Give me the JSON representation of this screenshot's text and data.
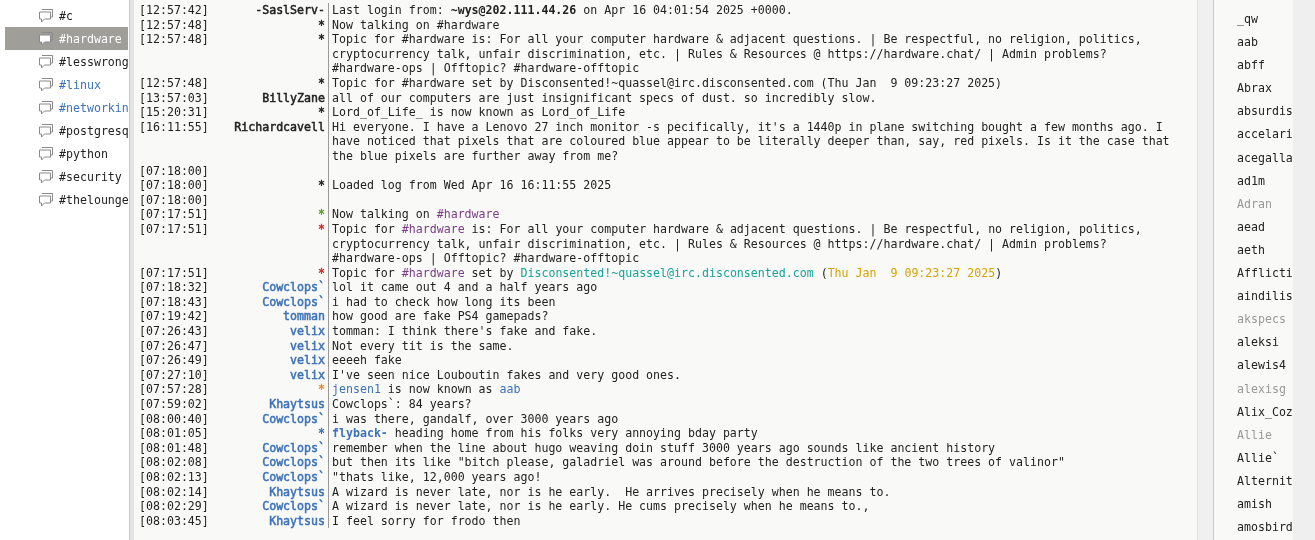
{
  "channels": [
    {
      "name": "#c",
      "selected": false,
      "activity": false
    },
    {
      "name": "#hardware",
      "selected": true,
      "activity": false
    },
    {
      "name": "#lesswrong",
      "selected": false,
      "activity": false
    },
    {
      "name": "#linux",
      "selected": false,
      "activity": true
    },
    {
      "name": "#networkin",
      "selected": false,
      "activity": true
    },
    {
      "name": "#postgresq",
      "selected": false,
      "activity": false
    },
    {
      "name": "#python",
      "selected": false,
      "activity": false
    },
    {
      "name": "#security",
      "selected": false,
      "activity": false
    },
    {
      "name": "#thelounge",
      "selected": false,
      "activity": false
    }
  ],
  "messages": [
    {
      "time": "[12:57:42]",
      "sender": "-SaslServ-",
      "color": "#222222",
      "parts": [
        {
          "text": "Last login from: "
        },
        {
          "text": "~wys@202.111.44.26",
          "kind": "bold"
        },
        {
          "text": " on Apr 16 04:01:54 2025 +0000."
        }
      ]
    },
    {
      "time": "[12:57:48]",
      "sender": "*",
      "color": "#222222",
      "parts": [
        {
          "text": "Now talking on #hardware"
        }
      ]
    },
    {
      "time": "[12:57:48]",
      "sender": "*",
      "color": "#222222",
      "parts": [
        {
          "text": "Topic for #hardware is: For all your computer hardware & adjacent questions. | Be respectful, no religion, politics, cryptocurrency talk, unfair discrimination, etc. | Rules & Resources @ https://hardware.chat/ | Admin problems? #hardware-ops | Offtopic? #hardware-offtopic"
        }
      ]
    },
    {
      "time": "[12:57:48]",
      "sender": "*",
      "color": "#222222",
      "parts": [
        {
          "text": "Topic for #hardware set by Disconsented!~quassel@irc.disconsented.com (Thu Jan  9 09:23:27 2025)"
        }
      ]
    },
    {
      "time": "[13:57:03]",
      "sender": "BillyZane",
      "color": "#222222",
      "parts": [
        {
          "text": "all of our computers are just insignificant specs of dust. so incredibly slow."
        }
      ]
    },
    {
      "time": "[15:20:31]",
      "sender": "*",
      "color": "#222222",
      "parts": [
        {
          "text": "Lord_of_Life_ is now known as Lord_of_Life"
        }
      ]
    },
    {
      "time": "[16:11:55]",
      "sender": "Richardcavell",
      "color": "#222222",
      "parts": [
        {
          "text": "Hi everyone. I have a Lenovo 27 inch monitor -s pecifically, it's a 1440p in plane switching bought a few months ago. I have noticed that pixels that are coloured blue appear to be literally deeper than, say, red pixels. Is it the case that the blue pixels are further away from me?"
        }
      ]
    },
    {
      "time": "[07:18:00]"
    },
    {
      "time": "[07:18:00]",
      "sender": "*",
      "color": "#222222",
      "parts": [
        {
          "text": "Loaded log from Wed Apr 16 16:11:55 2025"
        }
      ]
    },
    {
      "time": "[07:18:00]"
    },
    {
      "time": "[07:17:51]",
      "sender": "*",
      "color": "#5aa02c",
      "parts": [
        {
          "text": "Now talking on "
        },
        {
          "text": "#hardware",
          "kind": "channel"
        }
      ]
    },
    {
      "time": "[07:17:51]",
      "sender": "*",
      "color": "#d42b2b",
      "parts": [
        {
          "text": "Topic for "
        },
        {
          "text": "#hardware",
          "kind": "channel"
        },
        {
          "text": " is: For all your computer hardware & adjacent questions. | Be respectful, no religion, politics, cryptocurrency talk, unfair discrimination, etc. | Rules & Resources @ https://hardware.chat/ | Admin problems? #hardware-ops | Offtopic? #hardware-offtopic"
        }
      ]
    },
    {
      "time": "[07:17:51]",
      "sender": "*",
      "color": "#d42b2b",
      "parts": [
        {
          "text": "Topic for "
        },
        {
          "text": "#hardware",
          "kind": "channel"
        },
        {
          "text": " set by "
        },
        {
          "text": "Disconsented!~quassel@irc.disconsented.com",
          "kind": "host"
        },
        {
          "text": " ("
        },
        {
          "text": "Thu Jan  9 09:23:27 2025",
          "kind": "date"
        },
        {
          "text": ")"
        }
      ]
    },
    {
      "time": "[07:18:32]",
      "sender": "Cowclops`",
      "color": "#3d72b8",
      "parts": [
        {
          "text": "lol it came out 4 and a half years ago"
        }
      ]
    },
    {
      "time": "[07:18:43]",
      "sender": "Cowclops`",
      "color": "#3d72b8",
      "parts": [
        {
          "text": "i had to check how long its been"
        }
      ]
    },
    {
      "time": "[07:19:42]",
      "sender": "tomman",
      "color": "#3d72b8",
      "parts": [
        {
          "text": "how good are fake PS4 gamepads?"
        }
      ]
    },
    {
      "time": "[07:26:43]",
      "sender": "velix",
      "color": "#3d72b8",
      "parts": [
        {
          "text": "tomman: I think there's fake and fake."
        }
      ]
    },
    {
      "time": "[07:26:47]",
      "sender": "velix",
      "color": "#3d72b8",
      "parts": [
        {
          "text": "Not every tit is the same."
        }
      ]
    },
    {
      "time": "[07:26:49]",
      "sender": "velix",
      "color": "#3d72b8",
      "parts": [
        {
          "text": "eeeeh fake"
        }
      ]
    },
    {
      "time": "[07:27:10]",
      "sender": "velix",
      "color": "#3d72b8",
      "parts": [
        {
          "text": "I've seen nice Louboutin fakes and very good ones."
        }
      ]
    },
    {
      "time": "[07:57:28]",
      "sender": "*",
      "color": "#e8912f",
      "parts": [
        {
          "text": "jensen1",
          "kind": "nick"
        },
        {
          "text": " is now known as "
        },
        {
          "text": "aab",
          "kind": "nick"
        }
      ]
    },
    {
      "time": "[07:59:02]",
      "sender": "Khaytsus",
      "color": "#3d72b8",
      "parts": [
        {
          "text": "Cowclops`: 84 years?"
        }
      ]
    },
    {
      "time": "[08:00:40]",
      "sender": "Cowclops`",
      "color": "#3d72b8",
      "parts": [
        {
          "text": "i was there, gandalf, over 3000 years ago"
        }
      ]
    },
    {
      "time": "[08:01:05]",
      "sender": "*",
      "color": "#3d72b8",
      "parts": [
        {
          "text": "flyback-",
          "kind": "action"
        },
        {
          "text": " heading home from his folks very annoying bday party"
        }
      ]
    },
    {
      "time": "[08:01:48]",
      "sender": "Cowclops`",
      "color": "#3d72b8",
      "parts": [
        {
          "text": "remember when the line about hugo weaving doin stuff 3000 years ago sounds like ancient history"
        }
      ]
    },
    {
      "time": "[08:02:08]",
      "sender": "Cowclops`",
      "color": "#3d72b8",
      "parts": [
        {
          "text": "but then its like \"bitch please, galadriel was around before the destruction of the two trees of valinor\""
        }
      ]
    },
    {
      "time": "[08:02:13]",
      "sender": "Cowclops`",
      "color": "#3d72b8",
      "parts": [
        {
          "text": "\"thats like, 12,000 years ago!"
        }
      ]
    },
    {
      "time": "[08:02:14]",
      "sender": "Khaytsus",
      "color": "#3d72b8",
      "parts": [
        {
          "text": "A wizard is never late, nor is he early.  He arrives precisely when he means to."
        }
      ]
    },
    {
      "time": "[08:02:29]",
      "sender": "Cowclops`",
      "color": "#3d72b8",
      "parts": [
        {
          "text": "A wizard is never late, nor is he early. He cums precisely when he means to.,"
        }
      ]
    },
    {
      "time": "[08:03:45]",
      "sender": "Khaytsus",
      "color": "#3d72b8",
      "parts": [
        {
          "text": "I feel sorry for frodo then"
        }
      ]
    }
  ],
  "nicks": [
    {
      "name": "_qw",
      "away": false
    },
    {
      "name": "aab",
      "away": false
    },
    {
      "name": "abff",
      "away": false
    },
    {
      "name": "Abrax",
      "away": false
    },
    {
      "name": "absurdis",
      "away": false
    },
    {
      "name": "accelari",
      "away": false
    },
    {
      "name": "acegalla",
      "away": false
    },
    {
      "name": "ad1m",
      "away": false
    },
    {
      "name": "Adran",
      "away": true
    },
    {
      "name": "aead",
      "away": false
    },
    {
      "name": "aeth",
      "away": false
    },
    {
      "name": "Afflicti",
      "away": false
    },
    {
      "name": "aindilis",
      "away": false
    },
    {
      "name": "akspecs",
      "away": true
    },
    {
      "name": "aleksi",
      "away": false
    },
    {
      "name": "alewis4",
      "away": false
    },
    {
      "name": "alexisg",
      "away": true
    },
    {
      "name": "Alix_Coz",
      "away": false
    },
    {
      "name": "Allie",
      "away": true
    },
    {
      "name": "Allie`",
      "away": false
    },
    {
      "name": "Alternit",
      "away": false
    },
    {
      "name": "amish",
      "away": false
    },
    {
      "name": "amosbird",
      "away": false
    }
  ]
}
